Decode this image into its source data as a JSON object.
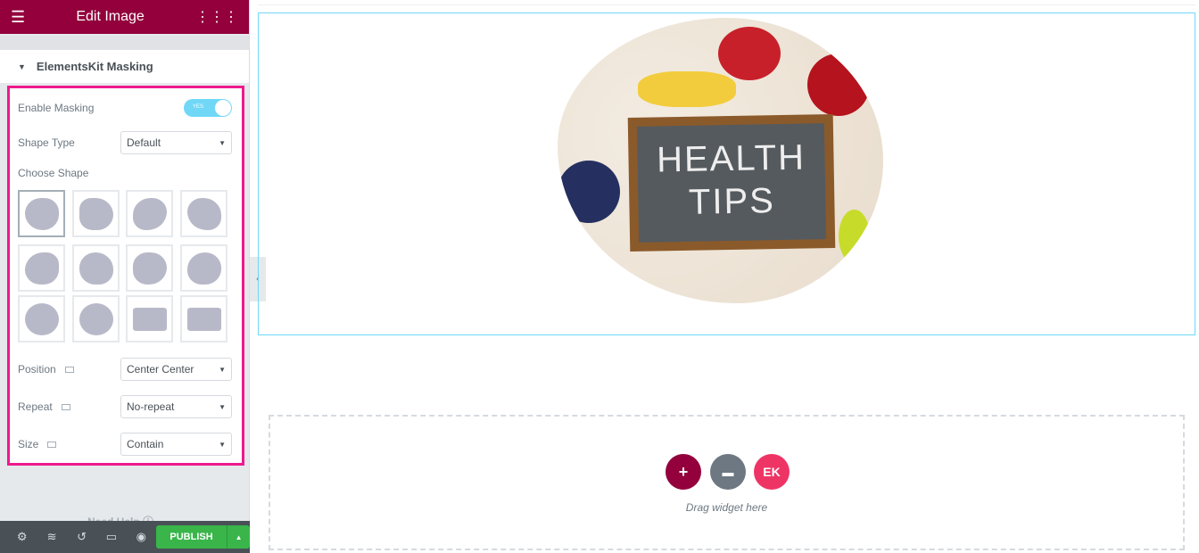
{
  "header": {
    "title": "Edit Image",
    "menu_icon": "hamburger-icon",
    "apps_icon": "grid-icon"
  },
  "section": {
    "title": "ElementsKit Masking"
  },
  "controls": {
    "enable_masking": {
      "label": "Enable Masking",
      "toggle": "YES",
      "value": true
    },
    "shape_type": {
      "label": "Shape Type",
      "value": "Default"
    },
    "choose_shape": {
      "label": "Choose Shape",
      "selected": 1,
      "count": 12
    },
    "position": {
      "label": "Position",
      "value": "Center Center"
    },
    "repeat": {
      "label": "Repeat",
      "value": "No-repeat"
    },
    "size": {
      "label": "Size",
      "value": "Contain"
    }
  },
  "need_help": "Need Help",
  "footer": {
    "publish": "PUBLISH",
    "icons": [
      "gear-icon",
      "layers-icon",
      "history-icon",
      "responsive-icon",
      "eye-icon"
    ]
  },
  "canvas": {
    "image_text_1": "HEALTH",
    "image_text_2": "TIPS",
    "drag_text": "Drag widget here"
  },
  "colors": {
    "brand": "#93003c",
    "highlight": "#ee1a8c",
    "publish": "#39b54a",
    "add": "#93003c",
    "folder": "#6d7882",
    "ek": "#ee3465"
  }
}
